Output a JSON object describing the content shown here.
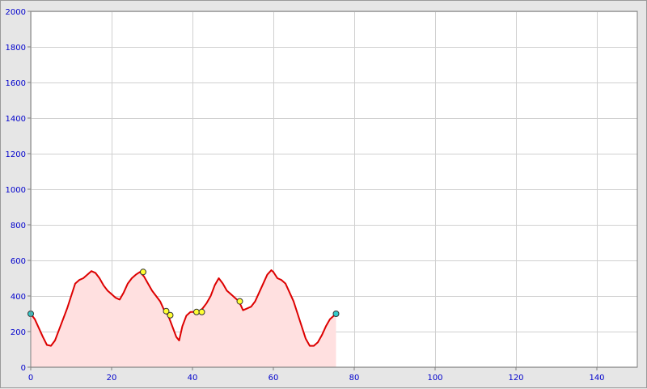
{
  "chart_data": {
    "type": "area",
    "title": "",
    "xlabel": "",
    "ylabel": "",
    "xlim": [
      0,
      150
    ],
    "ylim": [
      0,
      2000
    ],
    "x_ticks": [
      0,
      20,
      40,
      60,
      80,
      100,
      120,
      140
    ],
    "y_ticks": [
      0,
      200,
      400,
      600,
      800,
      1000,
      1200,
      1400,
      1600,
      1800,
      2000
    ],
    "grid": true,
    "legend": "none",
    "colors": {
      "line": "#dd0000",
      "fill": "#ffe0e0",
      "grid": "#d0d0d0",
      "tick_label": "#0000cc",
      "marker_endpoint": "#33cccc",
      "marker_waypoint": "#ffff33"
    },
    "series": [
      {
        "x": [
          0,
          1,
          2,
          3,
          4,
          5,
          6,
          7,
          8,
          9,
          10,
          11,
          12,
          13,
          14,
          15,
          16,
          17,
          18,
          19,
          20,
          21,
          22,
          23,
          24,
          25,
          26,
          27,
          28,
          29,
          30,
          31,
          32,
          33,
          34,
          35,
          36,
          36.7,
          37.5,
          38.5,
          39.5,
          40.5,
          41.5,
          42.5,
          43.5,
          44.5,
          45.5,
          46.5,
          47.5,
          48.5,
          49.5,
          50.5,
          51.5,
          52.5,
          53.5,
          54.5,
          55.5,
          56.5,
          57.5,
          58.5,
          59.5,
          60,
          61,
          62,
          63,
          64,
          65,
          66,
          67,
          68,
          69,
          70,
          71,
          72,
          73,
          74,
          75.5
        ],
        "values": [
          300,
          270,
          220,
          170,
          125,
          120,
          150,
          210,
          270,
          330,
          400,
          470,
          490,
          500,
          520,
          540,
          530,
          500,
          460,
          430,
          410,
          390,
          380,
          420,
          470,
          500,
          520,
          535,
          510,
          470,
          430,
          400,
          370,
          320,
          290,
          230,
          170,
          150,
          230,
          290,
          310,
          310,
          310,
          330,
          360,
          400,
          460,
          500,
          470,
          430,
          410,
          390,
          370,
          320,
          330,
          340,
          370,
          420,
          470,
          520,
          545,
          535,
          500,
          490,
          470,
          420,
          370,
          300,
          230,
          160,
          120,
          120,
          140,
          180,
          230,
          270,
          300
        ]
      }
    ],
    "markers": [
      {
        "x": 0,
        "y": 300,
        "kind": "endpoint"
      },
      {
        "x": 27.8,
        "y": 535,
        "kind": "waypoint"
      },
      {
        "x": 33.5,
        "y": 315,
        "kind": "waypoint"
      },
      {
        "x": 34.5,
        "y": 292,
        "kind": "waypoint"
      },
      {
        "x": 41,
        "y": 310,
        "kind": "waypoint"
      },
      {
        "x": 42.3,
        "y": 310,
        "kind": "waypoint"
      },
      {
        "x": 51.7,
        "y": 370,
        "kind": "waypoint"
      },
      {
        "x": 75.5,
        "y": 300,
        "kind": "endpoint"
      }
    ]
  }
}
